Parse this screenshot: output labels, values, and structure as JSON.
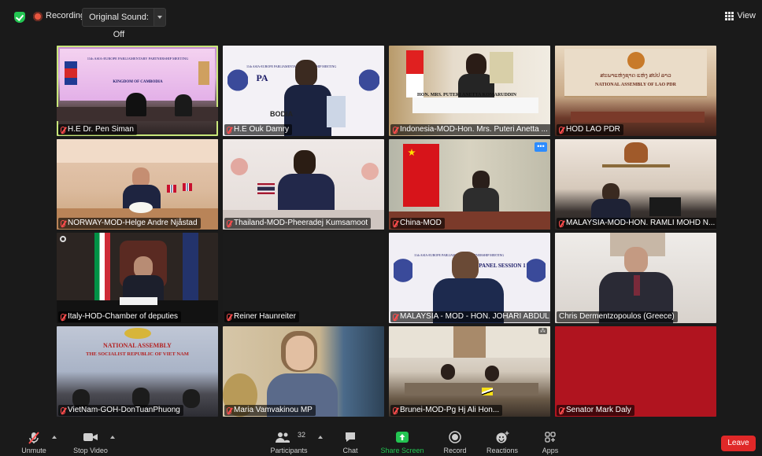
{
  "topbar": {
    "recording_label": "Recording",
    "original_sound_label": "Original Sound: Off",
    "view_label": "View"
  },
  "tiles": [
    {
      "name": "H.E Dr. Pen Siman",
      "banner": "11th ASIA-EUROPE PARLIAMENTARY PARTNERSHIP MEETING",
      "sub": "KINGDOM OF CAMBODIA"
    },
    {
      "name": "H.E Ouk Damry",
      "banner": "11th ASIA-EUROPE PARLIAMENTARY PARTNERSHIP MEETING",
      "big": "PA",
      "bodia": "BODIA"
    },
    {
      "name": "Indonesia-MOD-Hon. Mrs. Puteri Anetta ...",
      "placard": "HON. MRS. PUTERI ANETTA KOMARUDDIN"
    },
    {
      "name": "HOD LAO PDR",
      "banner": "ສະພາແຫ່ງຊາດ ແຫ່ງ ສປປ ລາວ",
      "sub": "NATIONAL ASSEMBLY OF LAO PDR"
    },
    {
      "name": "NORWAY-MOD-Helge Andre Njåstad"
    },
    {
      "name": "Thailand-MOD-Pheeradej Kumsamoot"
    },
    {
      "name": "China-MOD"
    },
    {
      "name": "MALAYSIA-MOD-HON. RAMLI MOHD N..."
    },
    {
      "name": "Italy-HOD-Chamber of deputies"
    },
    {
      "name": "Reiner Haunreiter"
    },
    {
      "name": "MALAYSIA - MOD - HON. JOHARI ABDUL",
      "banner": "11th ASIA-EUROPE PARLIAMENTARY PARTNERSHIP MEETING",
      "big": "PANEL SESSION 1"
    },
    {
      "name": "Chris Dermentzopoulos (Greece)"
    },
    {
      "name": "VietNam-GOH-DonTuanPhuong",
      "banner": "NATIONAL ASSEMBLY",
      "sub": "THE SOCIALIST REPUBLIC OF VIET NAM"
    },
    {
      "name": "Maria Vamvakinou MP"
    },
    {
      "name": "Brunei-MOD-Pg Hj Ali Hon..."
    },
    {
      "name": "Senator Mark Daly"
    }
  ],
  "toolbar": {
    "unmute": "Unmute",
    "stop_video": "Stop Video",
    "participants": "Participants",
    "participant_count": "32",
    "chat": "Chat",
    "share_screen": "Share Screen",
    "record": "Record",
    "reactions": "Reactions",
    "apps": "Apps",
    "leave": "Leave"
  },
  "colors": {
    "active_speaker_outline": "#c8e67a",
    "share_screen_green": "#23c552",
    "leave_red": "#e02828",
    "muted_red": "#ff4d4d"
  }
}
